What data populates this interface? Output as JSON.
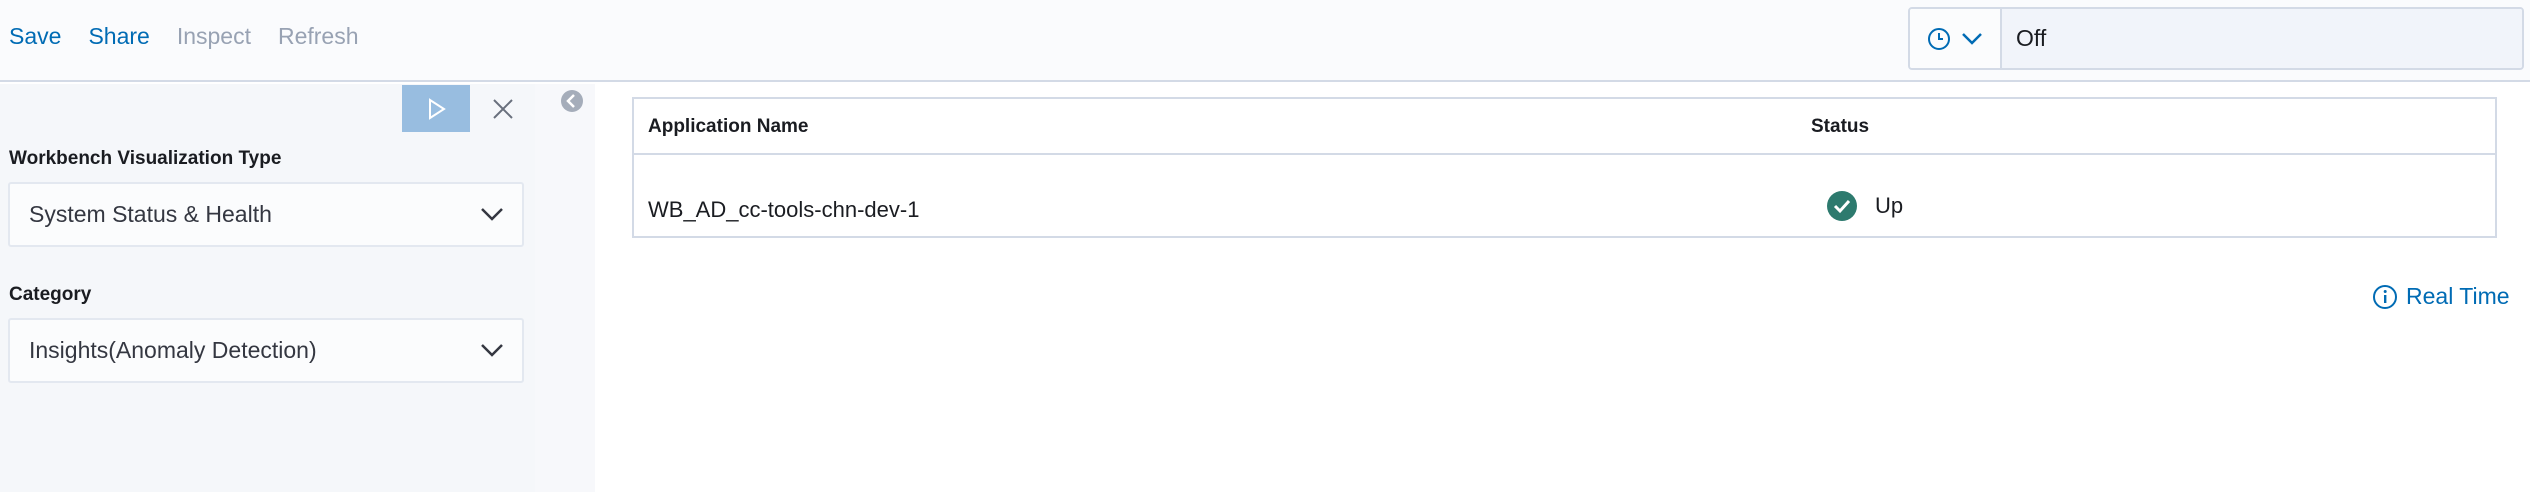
{
  "toolbar": {
    "save_label": "Save",
    "share_label": "Share",
    "inspect_label": "Inspect",
    "refresh_label": "Refresh"
  },
  "timepicker": {
    "refresh_value": "Off",
    "icon": "clock-icon"
  },
  "sidebar": {
    "visualization_type": {
      "label": "Workbench Visualization Type",
      "value": "System Status & Health"
    },
    "category": {
      "label": "Category",
      "value": "Insights(Anomaly Detection)"
    }
  },
  "table": {
    "columns": [
      "Application Name",
      "Status"
    ],
    "rows": [
      {
        "application_name": "WB_AD_cc-tools-chn-dev-1",
        "status": "Up"
      }
    ]
  },
  "footer_link": {
    "label": "Real Time",
    "icon": "info-icon"
  },
  "colors": {
    "accent": "#006bb4",
    "status_up": "#2d7a6e",
    "run_button": "#98bde0"
  }
}
